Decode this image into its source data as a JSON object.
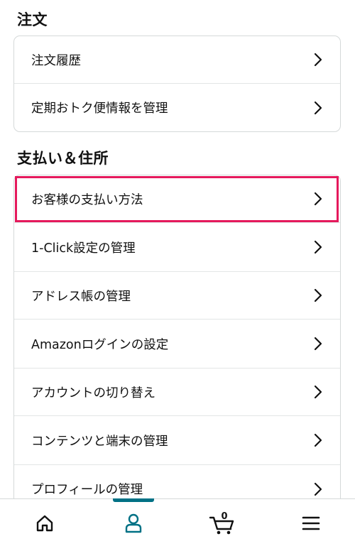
{
  "sections": {
    "orders": {
      "title": "注文",
      "items": [
        {
          "label": "注文履歴"
        },
        {
          "label": "定期おトク便情報を管理"
        }
      ]
    },
    "payments": {
      "title": "支払い＆住所",
      "items": [
        {
          "label": "お客様の支払い方法",
          "highlighted": true
        },
        {
          "label": "1-Click設定の管理"
        },
        {
          "label": "アドレス帳の管理"
        },
        {
          "label": "Amazonログインの設定"
        },
        {
          "label": "アカウントの切り替え"
        },
        {
          "label": "コンテンツと端末の管理"
        },
        {
          "label": "プロフィールの管理"
        }
      ]
    }
  },
  "bottom_nav": {
    "items": [
      {
        "icon": "home-icon"
      },
      {
        "icon": "account-icon",
        "active": true
      },
      {
        "icon": "cart-icon"
      },
      {
        "icon": "menu-icon"
      }
    ],
    "cart_count": "0"
  },
  "colors": {
    "highlight": "#e5195c",
    "active_tab": "#007185",
    "border": "#d5d9d9",
    "text": "#111111"
  }
}
